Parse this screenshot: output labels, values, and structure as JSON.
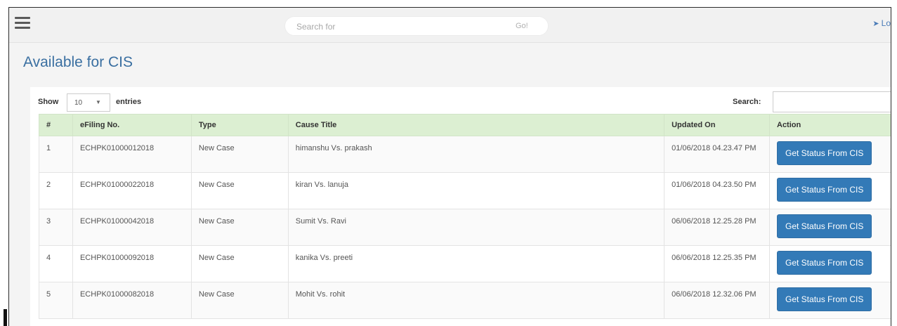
{
  "topbar": {
    "search_placeholder": "Search for",
    "search_go_label": "Go!",
    "logout_label": "Lo"
  },
  "page": {
    "title": "Available for CIS"
  },
  "controls": {
    "show_label": "Show",
    "entries_value": "10",
    "entries_label": "entries",
    "search_label": "Search:"
  },
  "table": {
    "headers": [
      "#",
      "eFiling No.",
      "Type",
      "Cause Title",
      "Updated On",
      "Action"
    ],
    "rows": [
      {
        "num": "1",
        "efiling": "ECHPK01000012018",
        "type": "New Case",
        "cause": "himanshu Vs. prakash",
        "updated": "01/06/2018 04.23.47 PM",
        "action": "Get Status From CIS"
      },
      {
        "num": "2",
        "efiling": "ECHPK01000022018",
        "type": "New Case",
        "cause": "kiran Vs. lanuja",
        "updated": "01/06/2018 04.23.50 PM",
        "action": "Get Status From CIS"
      },
      {
        "num": "3",
        "efiling": "ECHPK01000042018",
        "type": "New Case",
        "cause": "Sumit Vs. Ravi",
        "updated": "06/06/2018 12.25.28 PM",
        "action": "Get Status From CIS"
      },
      {
        "num": "4",
        "efiling": "ECHPK01000092018",
        "type": "New Case",
        "cause": "kanika Vs. preeti",
        "updated": "06/06/2018 12.25.35 PM",
        "action": "Get Status From CIS"
      },
      {
        "num": "5",
        "efiling": "ECHPK01000082018",
        "type": "New Case",
        "cause": "Mohit Vs. rohit",
        "updated": "06/06/2018 12.32.06 PM",
        "action": "Get Status From CIS"
      }
    ]
  },
  "icons": {
    "menu": "hamburger-icon",
    "logout": "sign-out-icon",
    "select_caret": "chevron-down-icon"
  },
  "colors": {
    "title": "#3a6fa1",
    "header_bg": "#dcefd2",
    "button_bg": "#337ab7"
  }
}
